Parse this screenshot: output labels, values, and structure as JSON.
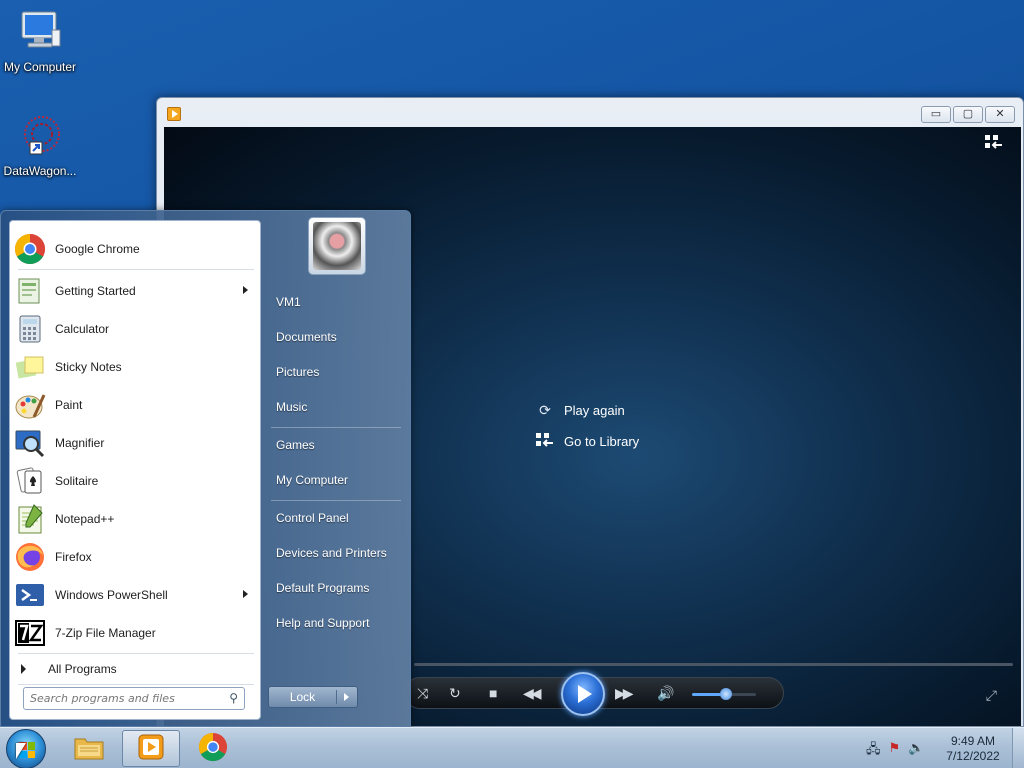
{
  "desktop": {
    "icons": [
      {
        "label": "My Computer",
        "icon": "monitor-icon"
      },
      {
        "label": "DataWagon...",
        "icon": "datawagon-shortcut-icon"
      }
    ]
  },
  "media_player": {
    "window_buttons": {
      "minimize": "▭",
      "maximize": "▢",
      "close": "✕"
    },
    "links": [
      {
        "label": "Play again",
        "icon": "replay-icon"
      },
      {
        "label": "Go to Library",
        "icon": "library-icon"
      }
    ],
    "controls": [
      "shuffle",
      "repeat",
      "stop",
      "previous",
      "play",
      "next",
      "mute",
      "volume"
    ],
    "volume_level_percent": 50
  },
  "start_menu": {
    "pinned": [
      {
        "label": "Google Chrome",
        "icon": "chrome-icon",
        "submenu": false
      }
    ],
    "recent": [
      {
        "label": "Getting Started",
        "icon": "getting-started-icon",
        "submenu": true
      },
      {
        "label": "Calculator",
        "icon": "calculator-icon",
        "submenu": false
      },
      {
        "label": "Sticky Notes",
        "icon": "sticky-notes-icon",
        "submenu": false
      },
      {
        "label": "Paint",
        "icon": "paint-icon",
        "submenu": false
      },
      {
        "label": "Magnifier",
        "icon": "magnifier-icon",
        "submenu": false
      },
      {
        "label": "Solitaire",
        "icon": "solitaire-icon",
        "submenu": false
      },
      {
        "label": "Notepad++",
        "icon": "notepadpp-icon",
        "submenu": false
      },
      {
        "label": "Firefox",
        "icon": "firefox-icon",
        "submenu": false
      },
      {
        "label": "Windows PowerShell",
        "icon": "powershell-icon",
        "submenu": true
      },
      {
        "label": "7-Zip File Manager",
        "icon": "7zip-icon",
        "submenu": false
      }
    ],
    "all_programs": "All Programs",
    "search_placeholder": "Search programs and files",
    "right_items": [
      {
        "label": "VM1"
      },
      {
        "label": "Documents"
      },
      {
        "label": "Pictures"
      },
      {
        "label": "Music"
      },
      {
        "label": "Games"
      },
      {
        "label": "My Computer"
      },
      {
        "label": "Control Panel"
      },
      {
        "label": "Devices and Printers"
      },
      {
        "label": "Default Programs"
      },
      {
        "label": "Help and Support"
      }
    ],
    "lock_label": "Lock"
  },
  "taskbar": {
    "buttons": [
      {
        "name": "windows-explorer",
        "icon": "folder-icon",
        "active": false
      },
      {
        "name": "windows-media-player",
        "icon": "media-player-icon",
        "active": true
      },
      {
        "name": "google-chrome",
        "icon": "chrome-icon",
        "active": false
      }
    ],
    "tray_icons": [
      "network-icon",
      "action-center-flag-icon",
      "volume-icon"
    ],
    "time": "9:49 AM",
    "date": "7/12/2022"
  }
}
